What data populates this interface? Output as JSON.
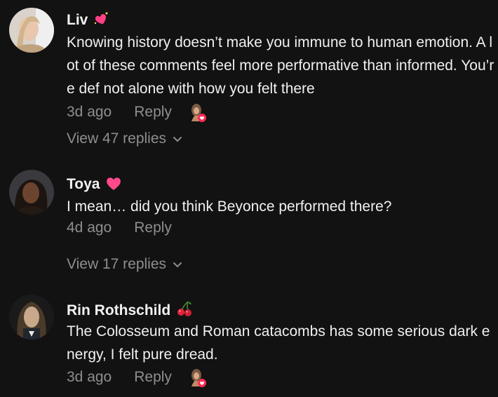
{
  "comments": [
    {
      "username": "Liv",
      "badge_emoji": "sparkling-heart",
      "text": "Knowing history doesn’t make you immune to human emotion. A lot of these comments feel more performative than informed. You’re def not alone with how you felt there",
      "time": "3d ago",
      "reply_label": "Reply",
      "creator_liked": true,
      "view_replies": "View 47 replies"
    },
    {
      "username": "Toya",
      "badge_emoji": "pink-heart",
      "text": "I mean… did you think Beyonce performed there?",
      "time": "4d ago",
      "reply_label": "Reply",
      "creator_liked": false,
      "view_replies": "View 17 replies"
    },
    {
      "username": "Rin Rothschild",
      "badge_emoji": "cherries",
      "text": "The Colosseum and Roman catacombs has some serious dark energy, I felt pure dread.",
      "time": "3d ago",
      "reply_label": "Reply",
      "creator_liked": true
    }
  ],
  "colors": {
    "background": "#121212",
    "text": "#f0f0f0",
    "muted": "#8e8e8e",
    "like_badge": "#fe2c55"
  }
}
